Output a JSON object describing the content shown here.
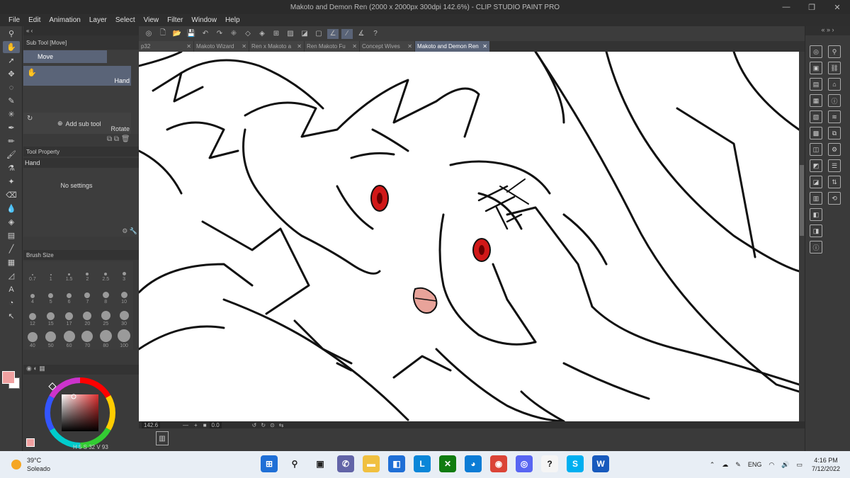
{
  "window": {
    "title": "Makoto and Demon Ren (2000 x 2000px 300dpi 142.6%)  - CLIP STUDIO PAINT PRO",
    "minimize": "—",
    "maximize": "❐",
    "close": "✕"
  },
  "menu": [
    "File",
    "Edit",
    "Animation",
    "Layer",
    "Select",
    "View",
    "Filter",
    "Window",
    "Help"
  ],
  "sub_tool": {
    "header": "Sub Tool [Move]",
    "group": "Move",
    "items": [
      {
        "label": "Hand"
      },
      {
        "label": "Rotate"
      }
    ],
    "add_label": "Add sub tool"
  },
  "tool_property": {
    "header": "Tool Property",
    "tool_name": "Hand",
    "empty_text": "No settings"
  },
  "brush_size": {
    "header": "Brush Size",
    "sizes": [
      "0.7",
      "1",
      "1.5",
      "2",
      "2.5",
      "3",
      "4",
      "5",
      "6",
      "7",
      "8",
      "10",
      "12",
      "15",
      "17",
      "20",
      "25",
      "30",
      "40",
      "50",
      "60",
      "70",
      "80",
      "100"
    ]
  },
  "color": {
    "main": "#f0a0a0",
    "sub": "#ffffff",
    "readout": {
      "h": "5",
      "s": "32",
      "v": "93"
    }
  },
  "tabs": [
    {
      "label": "p32",
      "active": false
    },
    {
      "label": "Makoto Wizard",
      "active": false
    },
    {
      "label": "Ren x Makoto a",
      "active": false
    },
    {
      "label": "Ren Makoto Fu",
      "active": false
    },
    {
      "label": "Concept Wives",
      "active": false
    },
    {
      "label": "Makoto and Demon Ren",
      "active": true
    }
  ],
  "status": {
    "zoom": "142.6",
    "angle": "0.0"
  },
  "taskbar": {
    "temperature": "39°C",
    "weather": "Soleado",
    "apps": [
      {
        "name": "windows-start",
        "glyph": "⊞",
        "color": "#1f6fd6"
      },
      {
        "name": "search",
        "glyph": "⚲",
        "color": "#333333"
      },
      {
        "name": "task-view",
        "glyph": "▣",
        "color": "#333333"
      },
      {
        "name": "chat",
        "glyph": "✆",
        "color": "#6264a7"
      },
      {
        "name": "file-explorer",
        "glyph": "▬",
        "color": "#f0c040"
      },
      {
        "name": "store",
        "glyph": "◧",
        "color": "#1f6fd6"
      },
      {
        "name": "l-app",
        "glyph": "L",
        "color": "#0a86d8"
      },
      {
        "name": "xbox",
        "glyph": "✕",
        "color": "#107c10"
      },
      {
        "name": "edge",
        "glyph": "◕",
        "color": "#0c7cd5"
      },
      {
        "name": "chrome",
        "glyph": "◉",
        "color": "#db4437"
      },
      {
        "name": "discord",
        "glyph": "◎",
        "color": "#5865f2"
      },
      {
        "name": "clip-studio",
        "glyph": "?",
        "color": "#ffffff"
      },
      {
        "name": "skype",
        "glyph": "S",
        "color": "#00aff0"
      },
      {
        "name": "word",
        "glyph": "W",
        "color": "#185abd"
      }
    ],
    "lang": "ENG",
    "time": "4:16 PM",
    "date": "7/12/2022"
  }
}
